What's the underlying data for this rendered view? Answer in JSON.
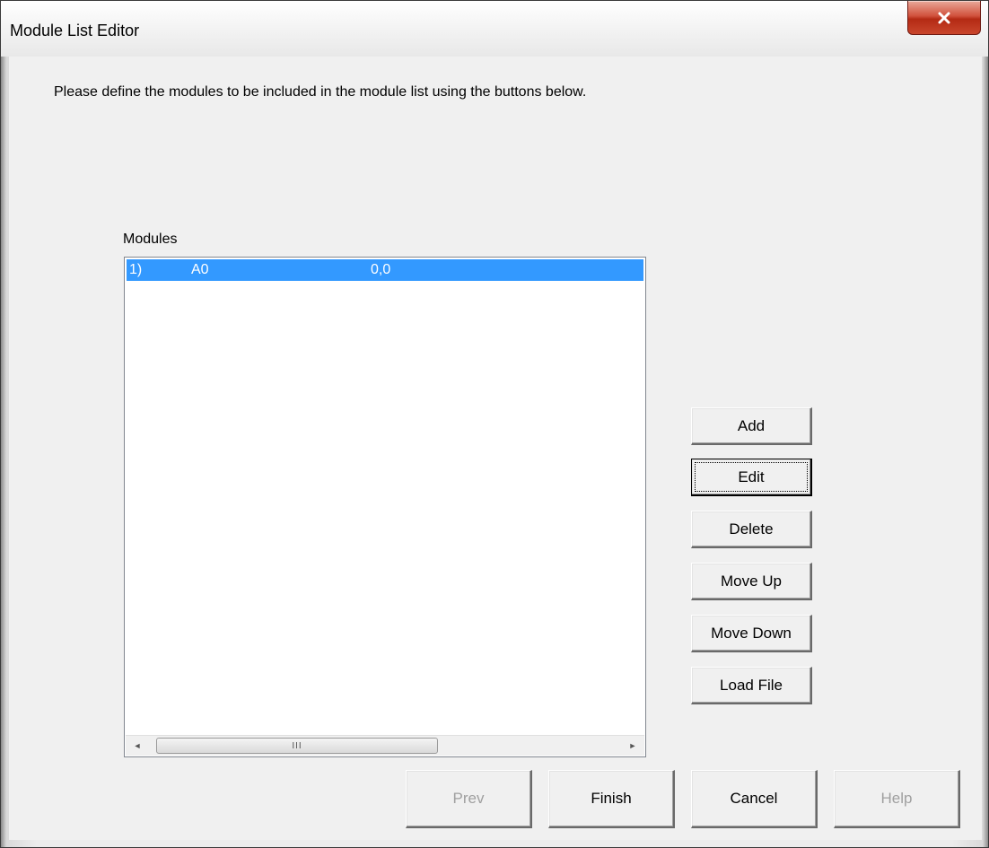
{
  "window": {
    "title": "Module List Editor",
    "close_glyph": "x"
  },
  "instructions": "Please define the modules to be included in the module list using the buttons below.",
  "modules": {
    "label": "Modules",
    "items": [
      {
        "index": "1)",
        "name": "A0",
        "value": "0,0",
        "selected": true
      }
    ],
    "scroll_thumb_grip": "III",
    "scroll_left_icon": "◄",
    "scroll_right_icon": "►"
  },
  "side_buttons": {
    "add": "Add",
    "edit": "Edit",
    "delete": "Delete",
    "move_up": "Move Up",
    "move_down": "Move Down",
    "load_file": "Load File"
  },
  "bottom_buttons": {
    "prev": "Prev",
    "finish": "Finish",
    "cancel": "Cancel",
    "help": "Help"
  },
  "colors": {
    "selection": "#3399ff",
    "close_button": "#c9462c",
    "disabled_text": "#a0a0a0"
  }
}
